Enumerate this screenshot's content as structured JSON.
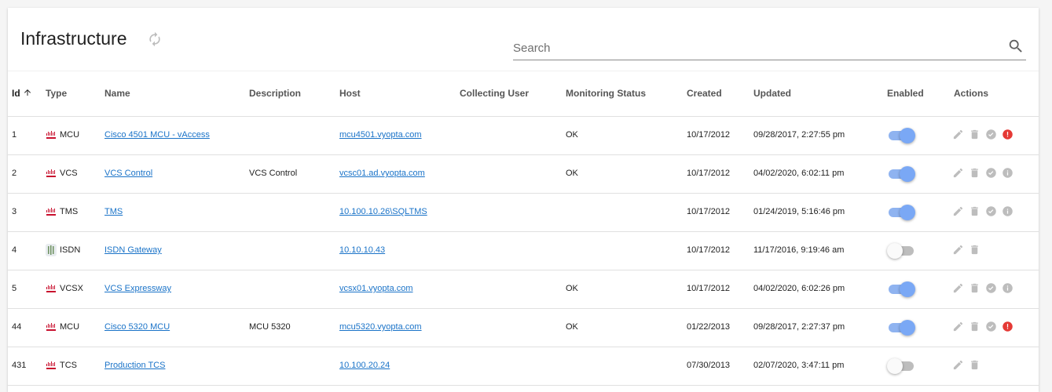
{
  "page": {
    "title": "Infrastructure",
    "search_placeholder": "Search"
  },
  "table": {
    "columns": {
      "id": "Id",
      "type": "Type",
      "name": "Name",
      "description": "Description",
      "host": "Host",
      "collecting_user": "Collecting User",
      "monitoring_status": "Monitoring Status",
      "created": "Created",
      "updated": "Updated",
      "enabled": "Enabled",
      "actions": "Actions"
    },
    "sort": {
      "column": "Id",
      "direction": "ascending"
    },
    "rows": [
      {
        "id": "1",
        "type": "MCU",
        "logo": "cisco",
        "name": "Cisco 4501 MCU - vAccess",
        "description": "",
        "host": "mcu4501.vyopta.com",
        "collecting_user": "",
        "status": "OK",
        "created": "10/17/2012",
        "updated": "09/28/2017, 2:27:55 pm",
        "enabled": true,
        "icons": [
          "edit-icon",
          "delete-icon",
          "check-circle-icon",
          "error-icon"
        ]
      },
      {
        "id": "2",
        "type": "VCS",
        "logo": "cisco",
        "name": "VCS Control",
        "description": "VCS Control",
        "host": "vcsc01.ad.vyopta.com",
        "collecting_user": "",
        "status": "OK",
        "created": "10/17/2012",
        "updated": "04/02/2020, 6:02:11 pm",
        "enabled": true,
        "icons": [
          "edit-icon",
          "delete-icon",
          "check-circle-icon",
          "info-icon"
        ]
      },
      {
        "id": "3",
        "type": "TMS",
        "logo": "cisco",
        "name": "TMS",
        "description": "",
        "host": "10.100.10.26\\SQLTMS",
        "collecting_user": "",
        "status": "",
        "created": "10/17/2012",
        "updated": "01/24/2019, 5:16:46 pm",
        "enabled": true,
        "icons": [
          "edit-icon",
          "delete-icon",
          "check-circle-icon",
          "info-icon"
        ]
      },
      {
        "id": "4",
        "type": "ISDN",
        "logo": "isdn",
        "name": "ISDN Gateway",
        "description": "",
        "host": "10.10.10.43",
        "collecting_user": "",
        "status": "",
        "created": "10/17/2012",
        "updated": "11/17/2016, 9:19:46 am",
        "enabled": false,
        "icons": [
          "edit-icon",
          "delete-icon"
        ]
      },
      {
        "id": "5",
        "type": "VCSX",
        "logo": "cisco",
        "name": "VCS Expressway",
        "description": "",
        "host": "vcsx01.vyopta.com",
        "collecting_user": "",
        "status": "OK",
        "created": "10/17/2012",
        "updated": "04/02/2020, 6:02:26 pm",
        "enabled": true,
        "icons": [
          "edit-icon",
          "delete-icon",
          "check-circle-icon",
          "info-icon"
        ]
      },
      {
        "id": "44",
        "type": "MCU",
        "logo": "cisco",
        "name": "Cisco 5320 MCU",
        "description": "MCU 5320",
        "host": "mcu5320.vyopta.com",
        "collecting_user": "",
        "status": "OK",
        "created": "01/22/2013",
        "updated": "09/28/2017, 2:27:37 pm",
        "enabled": true,
        "icons": [
          "edit-icon",
          "delete-icon",
          "check-circle-icon",
          "error-icon"
        ]
      },
      {
        "id": "431",
        "type": "TCS",
        "logo": "cisco",
        "name": "Production TCS",
        "description": "",
        "host": "10.100.20.24",
        "collecting_user": "",
        "status": "",
        "created": "07/30/2013",
        "updated": "02/07/2020, 3:47:11 pm",
        "enabled": false,
        "icons": [
          "edit-icon",
          "delete-icon"
        ]
      }
    ]
  },
  "colors": {
    "link": "#1a73c8",
    "toggle_on": "#7aa8f5",
    "error": "#e53935",
    "icon_gray": "#bdbdbd",
    "cisco_logo": "#c8102e"
  }
}
